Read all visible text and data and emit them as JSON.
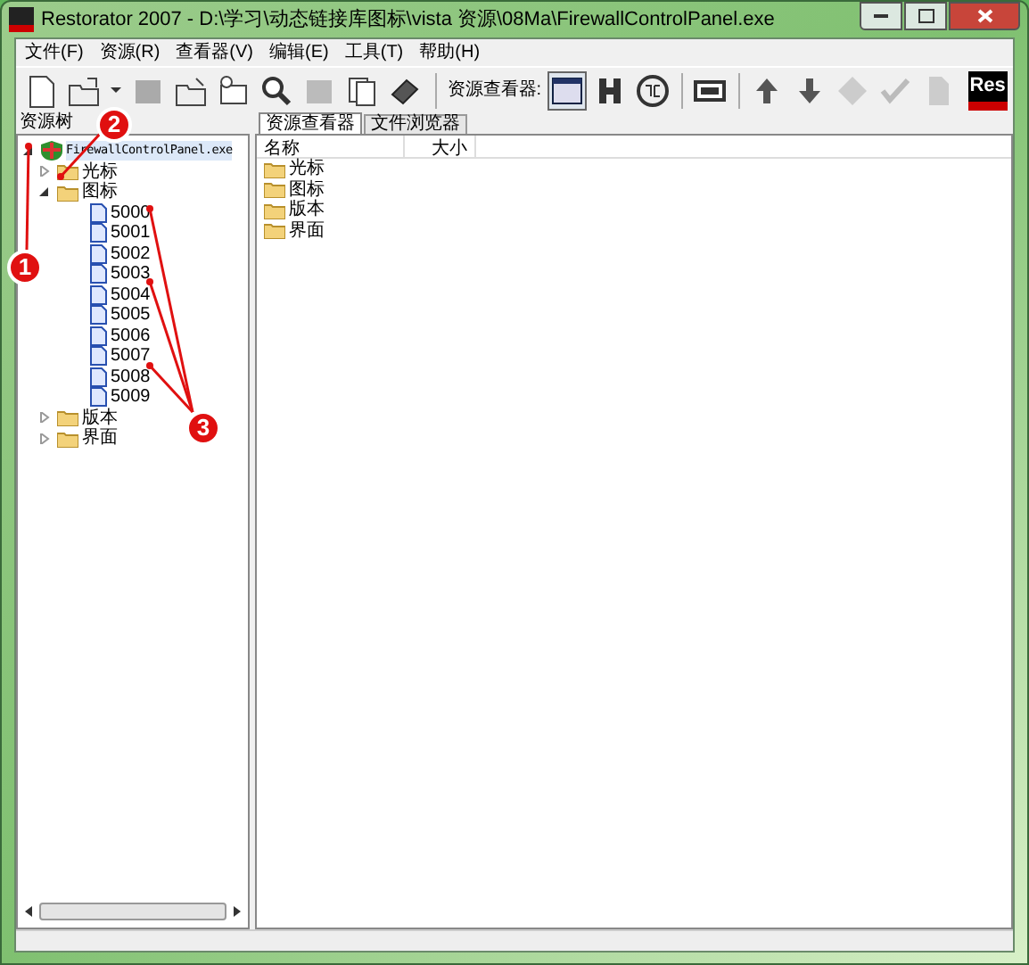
{
  "window": {
    "title": "Restorator 2007 - D:\\学习\\动态链接库图标\\vista 资源\\08Ma\\FirewallControlPanel.exe"
  },
  "menu": [
    "文件(F)",
    "资源(R)",
    "查看器(V)",
    "编辑(E)",
    "工具(T)",
    "帮助(H)"
  ],
  "toolbar": {
    "viewer_label": "资源查看器:",
    "logo": "Res"
  },
  "tree": {
    "title": "资源树",
    "root": {
      "label": "FirewallControlPanel.exe",
      "expanded": true,
      "selected": true,
      "children": [
        {
          "label": "光标",
          "expanded": false,
          "kind": "folder"
        },
        {
          "label": "图标",
          "expanded": true,
          "kind": "folder",
          "children": [
            {
              "label": "5000",
              "kind": "file"
            },
            {
              "label": "5001",
              "kind": "file"
            },
            {
              "label": "5002",
              "kind": "file"
            },
            {
              "label": "5003",
              "kind": "file"
            },
            {
              "label": "5004",
              "kind": "file"
            },
            {
              "label": "5005",
              "kind": "file"
            },
            {
              "label": "5006",
              "kind": "file"
            },
            {
              "label": "5007",
              "kind": "file"
            },
            {
              "label": "5008",
              "kind": "file"
            },
            {
              "label": "5009",
              "kind": "file"
            }
          ]
        },
        {
          "label": "版本",
          "expanded": false,
          "kind": "folder"
        },
        {
          "label": "界面",
          "expanded": false,
          "kind": "folder"
        }
      ]
    }
  },
  "tabs": [
    {
      "label": "资源查看器",
      "selected": true
    },
    {
      "label": "文件浏览器",
      "selected": false
    }
  ],
  "list": {
    "columns": [
      "名称",
      "大小"
    ],
    "items": [
      "光标",
      "图标",
      "版本",
      "界面"
    ]
  },
  "annotations": [
    "1",
    "2",
    "3"
  ]
}
